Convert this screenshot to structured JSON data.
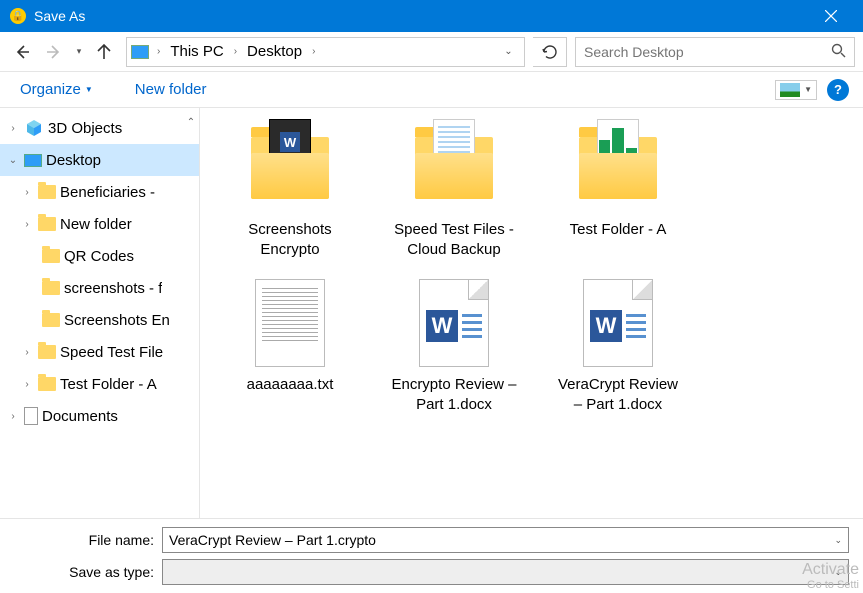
{
  "window": {
    "title": "Save As"
  },
  "nav": {
    "breadcrumb": [
      "This PC",
      "Desktop"
    ],
    "search_placeholder": "Search Desktop"
  },
  "toolbar": {
    "organize": "Organize",
    "newfolder": "New folder"
  },
  "tree": [
    {
      "id": "3dobjects",
      "label": "3D Objects",
      "icon": "cube",
      "exp": "closed",
      "indent": 0
    },
    {
      "id": "desktop",
      "label": "Desktop",
      "icon": "monitor",
      "exp": "open",
      "indent": 0,
      "selected": true
    },
    {
      "id": "beneficiaries",
      "label": "Beneficiaries - ",
      "icon": "folder",
      "exp": "closed",
      "indent": 1
    },
    {
      "id": "newfolder",
      "label": "New folder",
      "icon": "folder",
      "exp": "closed",
      "indent": 1
    },
    {
      "id": "qrcodes",
      "label": "QR Codes",
      "icon": "folder",
      "exp": "",
      "indent": 2
    },
    {
      "id": "screenshots-f",
      "label": "screenshots - f",
      "icon": "folder",
      "exp": "",
      "indent": 2
    },
    {
      "id": "screenshots-en",
      "label": "Screenshots En",
      "icon": "folder",
      "exp": "",
      "indent": 2
    },
    {
      "id": "speedtest",
      "label": "Speed Test File",
      "icon": "folder",
      "exp": "closed",
      "indent": 1
    },
    {
      "id": "testfolder",
      "label": "Test Folder - A",
      "icon": "folder",
      "exp": "closed",
      "indent": 1
    },
    {
      "id": "documents",
      "label": "Documents",
      "icon": "doc",
      "exp": "closed",
      "indent": 0
    }
  ],
  "files": [
    {
      "id": "screenshots-encrypto",
      "label": "Screenshots Encrypto",
      "kind": "folder-dark"
    },
    {
      "id": "speedtest-files",
      "label": "Speed Test Files - Cloud Backup",
      "kind": "folder-sheets"
    },
    {
      "id": "testfolder-a",
      "label": "Test Folder - A",
      "kind": "folder-green"
    },
    {
      "id": "aaaaaaaa",
      "label": "aaaaaaaa.txt",
      "kind": "txt"
    },
    {
      "id": "encrypto-review",
      "label": "Encrypto Review – Part 1.docx",
      "kind": "docx"
    },
    {
      "id": "veracrypt-review",
      "label": "VeraCrypt Review – Part 1.docx",
      "kind": "docx"
    }
  ],
  "footer": {
    "filename_label": "File name:",
    "filename_value": "VeraCrypt Review – Part 1.crypto",
    "savetype_label": "Save as type:",
    "savetype_value": ""
  },
  "watermark": {
    "line1": "Activate",
    "line2": "Go to Setti"
  }
}
